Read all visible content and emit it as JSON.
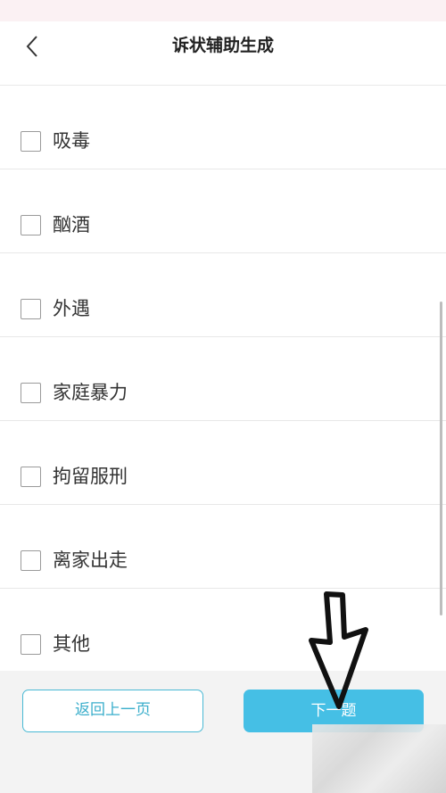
{
  "header": {
    "title": "诉状辅助生成",
    "back_icon": "chevron-left-icon"
  },
  "options": [
    {
      "label": "吸毒",
      "checked": false
    },
    {
      "label": "酗酒",
      "checked": false
    },
    {
      "label": "外遇",
      "checked": false
    },
    {
      "label": "家庭暴力",
      "checked": false
    },
    {
      "label": "拘留服刑",
      "checked": false
    },
    {
      "label": "离家出走",
      "checked": false
    },
    {
      "label": "其他",
      "checked": false
    }
  ],
  "footer": {
    "prev_label": "返回上一页",
    "next_label": "下一题"
  },
  "colors": {
    "accent": "#45bfe5",
    "accent_border": "#49b9d4",
    "status_strip": "#fbf1f3"
  }
}
